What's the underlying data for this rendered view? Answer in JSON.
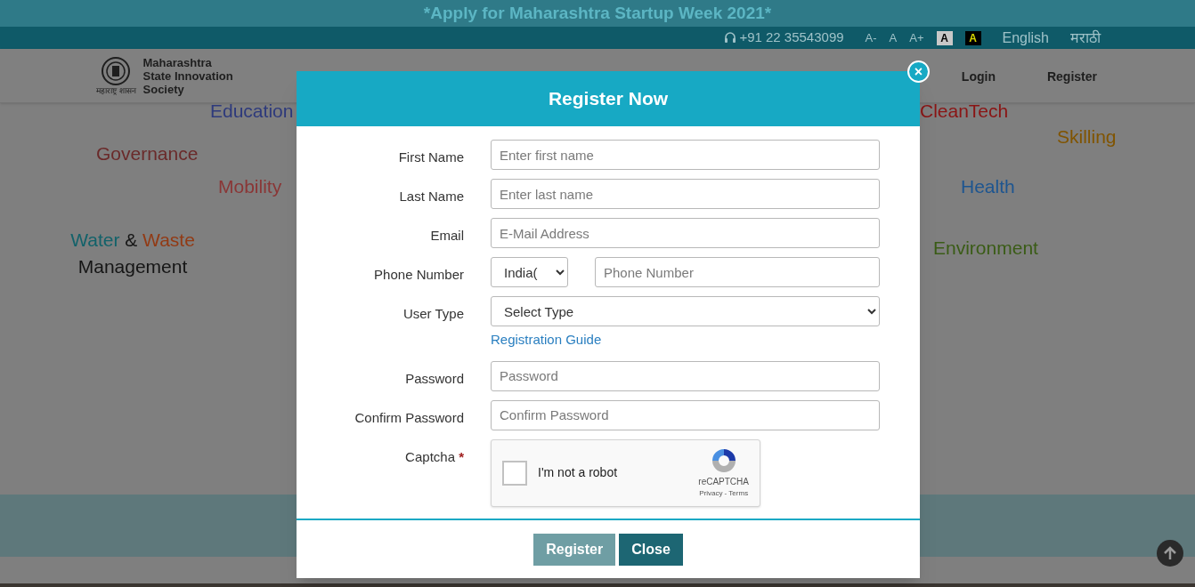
{
  "banner": {
    "text": "*Apply for Maharashtra Startup Week 2021*"
  },
  "top_bar": {
    "phone": "+91 22 35543099",
    "font_sizes": [
      "A-",
      "A",
      "A+"
    ],
    "contrast": [
      {
        "label": "A",
        "kind": "light"
      },
      {
        "label": "A",
        "kind": "dark"
      }
    ],
    "languages": [
      "English",
      "मराठी"
    ]
  },
  "header": {
    "logo_caption": "महाराष्ट्र शासन",
    "logo_lines": [
      "Maharashtra",
      "State Innovation",
      "Society"
    ],
    "nav": [
      "Login",
      "Register"
    ]
  },
  "topics": [
    {
      "words": [
        {
          "text": "Education",
          "color": "#2e3a7c"
        }
      ]
    },
    {
      "words": [
        {
          "text": "Governance",
          "color": "#6a2a2a"
        }
      ]
    },
    {
      "words": [
        {
          "text": "Mobility",
          "color": "#8a3636"
        }
      ]
    },
    {
      "words": [
        {
          "text": "Water",
          "color": "#12626a"
        },
        {
          "text": "&",
          "color": "#151515"
        },
        {
          "text": "Waste",
          "color": "#923a14"
        },
        {
          "text": "Management",
          "color": "#151515"
        }
      ]
    },
    {
      "words": [
        {
          "text": "CleanTech",
          "color": "#8a1414"
        }
      ]
    },
    {
      "words": [
        {
          "text": "Skilling",
          "color": "#805400"
        }
      ]
    },
    {
      "words": [
        {
          "text": "Health",
          "color": "#1d5590"
        }
      ]
    },
    {
      "words": [
        {
          "text": "Environment",
          "color": "#3a5c16"
        }
      ]
    }
  ],
  "modal": {
    "title": "Register Now",
    "close_icon": "×",
    "fields": [
      {
        "kind": "input",
        "label": "First Name",
        "placeholder": "Enter first name"
      },
      {
        "kind": "input",
        "label": "Last Name",
        "placeholder": "Enter last name"
      },
      {
        "kind": "input",
        "label": "Email",
        "placeholder": "E-Mail Address"
      },
      {
        "kind": "phone",
        "label": "Phone Number",
        "country": "India(",
        "placeholder": "Phone Number"
      },
      {
        "kind": "select",
        "label": "User Type",
        "value": "Select Type",
        "link": "Registration Guide"
      },
      {
        "kind": "input",
        "label": "Password",
        "placeholder": "Password"
      },
      {
        "kind": "input",
        "label": "Confirm Password",
        "placeholder": "Confirm Password"
      },
      {
        "kind": "captcha",
        "label": "Captcha",
        "required": "*",
        "checkbox_label": "I'm not a robot",
        "checked": false,
        "brand": "reCAPTCHA",
        "links": "Privacy - Terms"
      }
    ],
    "buttons": [
      {
        "label": "Register",
        "kind": "primary"
      },
      {
        "label": "Close",
        "kind": "secondary"
      }
    ]
  }
}
